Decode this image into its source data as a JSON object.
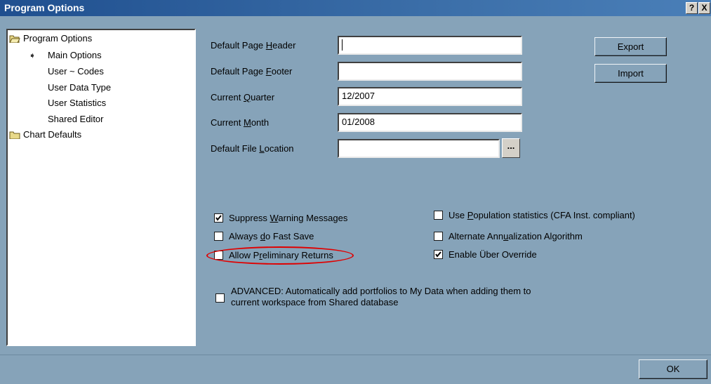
{
  "window": {
    "title": "Program Options",
    "help_label": "?",
    "close_label": "X"
  },
  "tree": {
    "items": [
      {
        "label": "Program Options"
      },
      {
        "label": "Main Options"
      },
      {
        "label": "User ~ Codes"
      },
      {
        "label": "User Data Type"
      },
      {
        "label": "User Statistics"
      },
      {
        "label": "Shared Editor"
      },
      {
        "label": "Chart Defaults"
      }
    ]
  },
  "form": {
    "header_label_pre": "Default Page ",
    "header_label_key": "H",
    "header_label_post": "eader",
    "header_value": "",
    "footer_label_pre": "Default Page ",
    "footer_label_key": "F",
    "footer_label_post": "ooter",
    "footer_value": "",
    "quarter_label_pre": "Current ",
    "quarter_label_key": "Q",
    "quarter_label_post": "uarter",
    "quarter_value": "12/2007",
    "month_label_pre": "Current ",
    "month_label_key": "M",
    "month_label_post": "onth",
    "month_value": "01/2008",
    "location_label_pre": "Default File ",
    "location_label_key": "L",
    "location_label_post": "ocation",
    "location_value": "",
    "browse_label": "...",
    "export_label": "Export",
    "import_label": "Import"
  },
  "options": {
    "suppress": {
      "pre": "Suppress ",
      "key": "W",
      "post": "arning Messages",
      "checked": true
    },
    "fast_save": {
      "pre": "Always ",
      "key": "d",
      "post": "o Fast Save",
      "checked": false
    },
    "preliminary": {
      "pre": "Allow P",
      "key": "r",
      "post": "eliminary Returns",
      "checked": false
    },
    "population": {
      "pre": "Use ",
      "key": "P",
      "post": "opulation statistics (CFA Inst. compliant)",
      "checked": false
    },
    "annualization": {
      "pre": "Alternate Ann",
      "key": "u",
      "post": "alization Algorithm",
      "checked": false
    },
    "uber": {
      "label": "Enable Über Override",
      "checked": true
    },
    "advanced": {
      "line1": "ADVANCED: Automatically add portfolios to My Data when adding them to",
      "line2": "current workspace from Shared database",
      "checked": false
    }
  },
  "footer": {
    "ok_label": "OK"
  }
}
